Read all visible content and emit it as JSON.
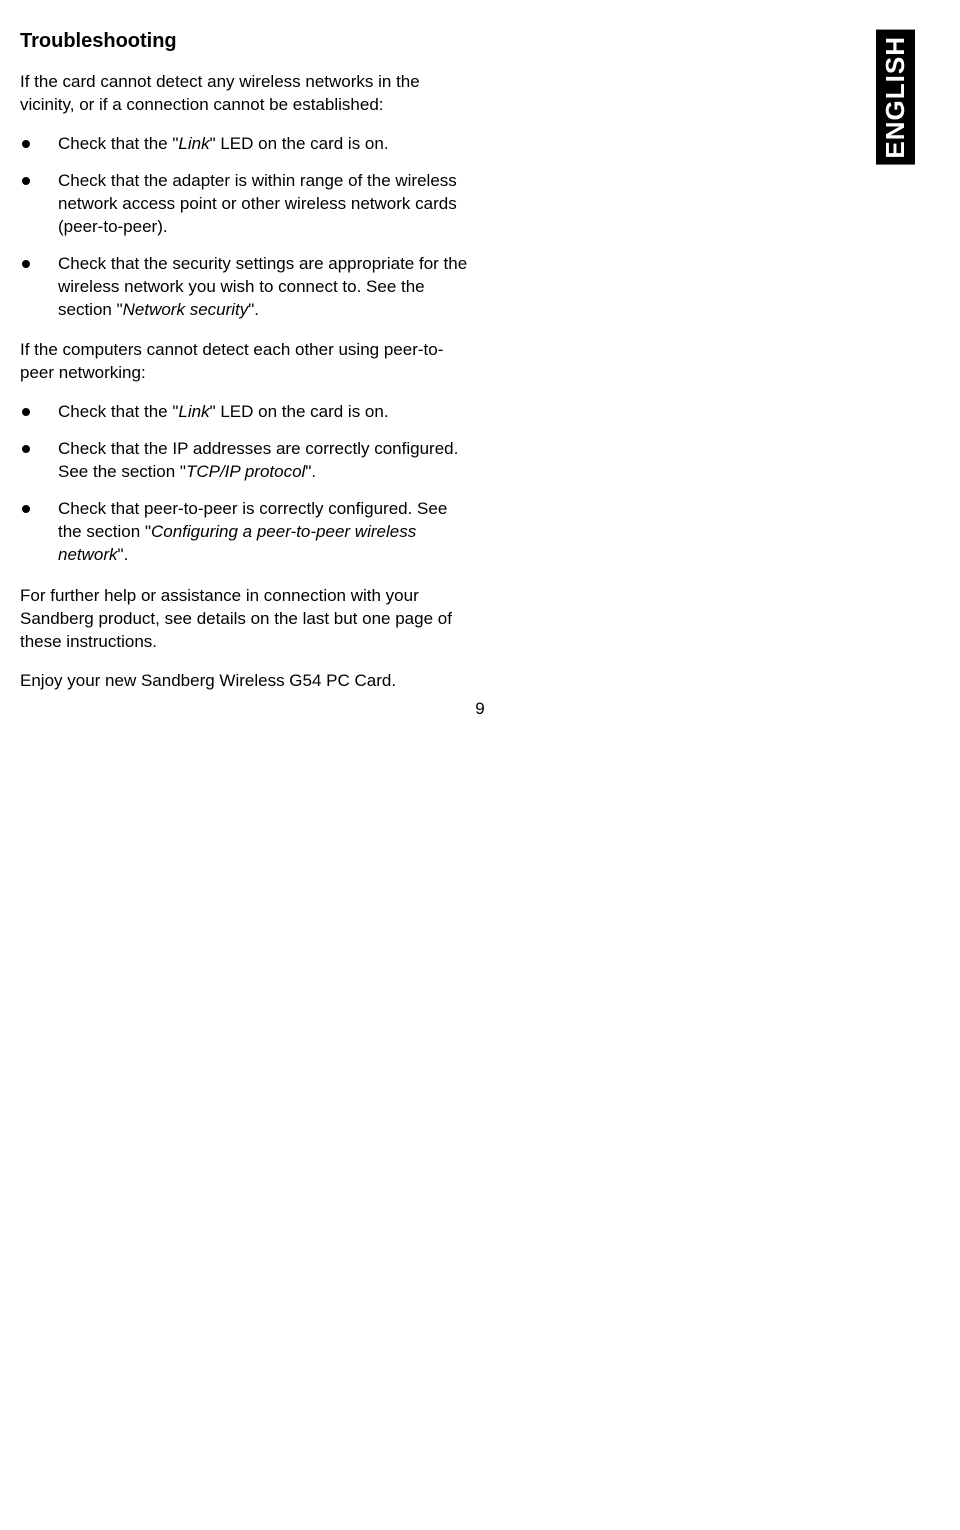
{
  "sidebar": {
    "language": "ENGLISH"
  },
  "heading": "Troubleshooting",
  "intro1": "If the card cannot detect any wireless networks in the vicinity, or if a connection cannot be established:",
  "list1": {
    "item1_pre": "Check that the \"",
    "item1_it": "Link",
    "item1_post": "\" LED on the card is on.",
    "item2": "Check that the adapter is within range of the wireless network access point or other wireless network cards (peer-to-peer).",
    "item3_pre": "Check that the security settings are appropriate for the wireless network you wish to connect to. See the section \"",
    "item3_it": "Network security",
    "item3_post": "\"."
  },
  "intro2": "If the computers cannot detect each other using peer-to-peer networking:",
  "list2": {
    "item1_pre": "Check that the \"",
    "item1_it": "Link",
    "item1_post": "\" LED on the card is on.",
    "item2_pre": "Check that the IP addresses are correctly configured. See the section \"",
    "item2_it": "TCP/IP protocol",
    "item2_post": "\".",
    "item3_pre": "Check that peer-to-peer is correctly configured. See the section \"",
    "item3_it": "Configuring a peer-to-peer wireless network",
    "item3_post": "\"."
  },
  "closing1": "For further help or assistance in connection with your Sandberg product, see details on the last but one page of these instructions.",
  "closing2": "Enjoy your new Sandberg Wireless G54 PC Card.",
  "page_number": "9"
}
